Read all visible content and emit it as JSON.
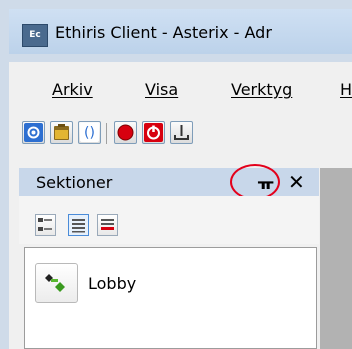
{
  "window": {
    "title": "Ethiris Client - Asterix - Adr",
    "app_icon_text": "Ec",
    "app_icon": "ethiris-client-icon"
  },
  "menu": {
    "items": [
      {
        "label": "Arkiv"
      },
      {
        "label": "Visa"
      },
      {
        "label": "Verktyg"
      },
      {
        "label": "H"
      }
    ]
  },
  "toolbar": {
    "buttons": [
      {
        "icon": "gear-icon"
      },
      {
        "icon": "briefcase-icon"
      },
      {
        "icon": "refresh-icon"
      },
      {
        "icon": "record-icon"
      },
      {
        "icon": "power-icon"
      },
      {
        "icon": "export-icon"
      }
    ]
  },
  "sections_panel": {
    "title": "Sektioner",
    "pin_icon": "pin-icon",
    "close_icon": "close-icon",
    "pin_glyph": "ᚂ",
    "close_glyph": "✕",
    "highlight_color": "#e3001b",
    "view_buttons": [
      {
        "icon": "tree-view-icon",
        "active": false
      },
      {
        "icon": "list-view-icon",
        "active": true
      },
      {
        "icon": "red-list-view-icon",
        "active": false
      }
    ],
    "items": [
      {
        "label": "Lobby",
        "icon": "lobby-section-icon"
      }
    ]
  }
}
